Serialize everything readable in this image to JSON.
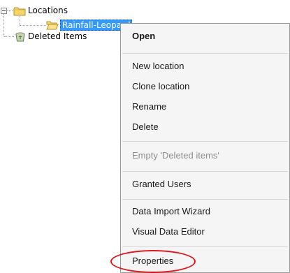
{
  "tree": {
    "root_label": "Locations",
    "child_label": "Rainfall-Leopard",
    "deleted_label": "Deleted Items"
  },
  "menu": {
    "open": "Open",
    "new_location": "New location",
    "clone_location": "Clone location",
    "rename": "Rename",
    "delete": "Delete",
    "empty_deleted": "Empty 'Deleted items'",
    "granted_users": "Granted Users",
    "data_import_wizard": "Data Import Wizard",
    "visual_data_editor": "Visual Data Editor",
    "properties": "Properties"
  },
  "icons": {
    "folder": "folder-icon",
    "open_folder": "open-folder-icon",
    "recycle_bin": "recycle-bin-icon",
    "expander": "collapse-minus-icon"
  },
  "colors": {
    "selection": "#3399ff",
    "highlight_oval": "#e0151b",
    "menu_bg": "#f5f5f5"
  }
}
